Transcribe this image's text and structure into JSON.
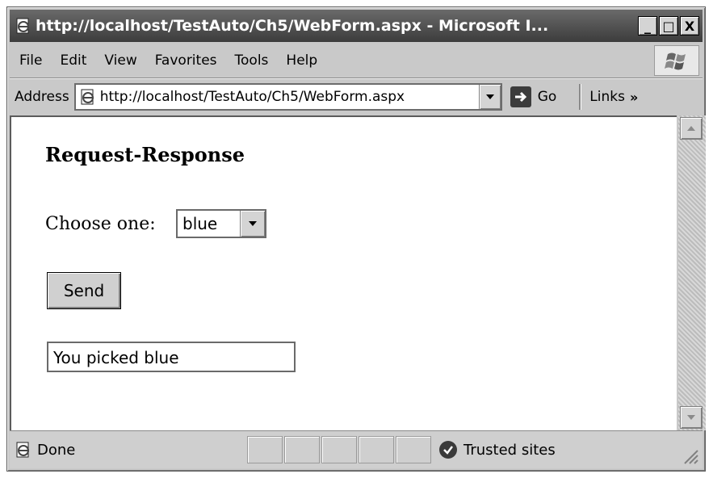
{
  "window": {
    "title": "http://localhost/TestAuto/Ch5/WebForm.aspx - Microsoft I...",
    "controls": {
      "minimize": "_",
      "maximize": "□",
      "close": "X"
    }
  },
  "menubar": {
    "items": [
      "File",
      "Edit",
      "View",
      "Favorites",
      "Tools",
      "Help"
    ]
  },
  "addressbar": {
    "label": "Address",
    "url": "http://localhost/TestAuto/Ch5/WebForm.aspx",
    "go_label": "Go",
    "links_label": "Links",
    "links_chevron": "»"
  },
  "page": {
    "heading": "Request-Response",
    "choose_label": "Choose one:",
    "select_value": "blue",
    "send_label": "Send",
    "result_value": "You picked blue"
  },
  "statusbar": {
    "status_text": "Done",
    "zone_text": "Trusted sites"
  },
  "icons": {
    "title": "ie-page-icon",
    "logo": "windows-flag-icon",
    "address": "ie-page-icon",
    "go": "right-arrow-icon",
    "status": "ie-page-icon",
    "zone": "checkmark-icon"
  }
}
